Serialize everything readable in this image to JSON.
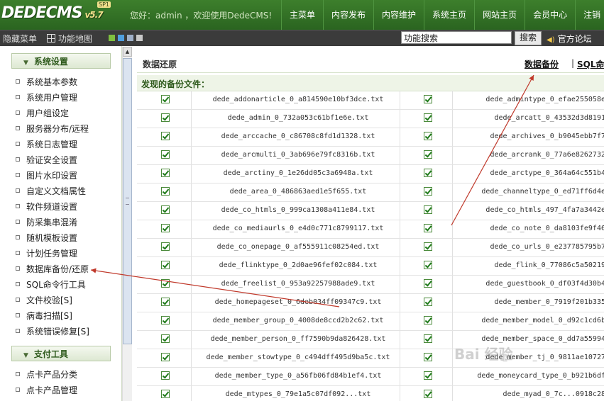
{
  "header": {
    "logo_text": "DEDECMS",
    "version": "v5.7",
    "badge": "SP1",
    "welcome": "您好：admin ，欢迎使用DedeCMS!",
    "nav": [
      "主菜单",
      "内容发布",
      "内容维护",
      "系统主页",
      "网站主页",
      "会员中心",
      "注销"
    ]
  },
  "toolbar": {
    "hide_menu": "隐藏菜单",
    "func_map": "功能地图",
    "search_value": "功能搜索",
    "search_button": "搜索",
    "forum": "官方论坛",
    "swatches": [
      "#7fbf3f",
      "#4f9fe0",
      "#9fb0c8",
      "#c8c8c8"
    ]
  },
  "sidebar": {
    "sections": [
      {
        "title": "系统设置",
        "items": [
          "系统基本参数",
          "系统用户管理",
          "用户组设定",
          "服务器分布/远程",
          "系统日志管理",
          "验证安全设置",
          "图片水印设置",
          "自定义文档属性",
          "软件频道设置",
          "防采集串混淆",
          "随机模板设置",
          "计划任务管理",
          "数据库备份/还原",
          "SQL命令行工具",
          "文件校验[S]",
          "病毒扫描[S]",
          "系统错误修复[S]"
        ]
      },
      {
        "title": "支付工具",
        "items": [
          "点卡产品分类",
          "点卡产品管理"
        ]
      }
    ]
  },
  "main": {
    "title": "数据还原",
    "link_backup": "数据备份",
    "link_sql": "SQL命",
    "subheading": "发现的备份文件：",
    "rows": [
      [
        "dede_addonarticle_0_a814590e10bf3dce.txt",
        "dede_admintype_0_efae255058e"
      ],
      [
        "dede_admin_0_732a053c61bf1e6e.txt",
        "dede_arcatt_0_43532d3d8191"
      ],
      [
        "dede_arccache_0_c86708c8fd1d1328.txt",
        "dede_archives_0_b9045ebb7f7"
      ],
      [
        "dede_arcmulti_0_3ab696e79fc8316b.txt",
        "dede_arcrank_0_77a6e8262732"
      ],
      [
        "dede_arctiny_0_1e26dd05c3a6948a.txt",
        "dede_arctype_0_364a64c551b4"
      ],
      [
        "dede_area_0_486863aed1e5f655.txt",
        "dede_channeltype_0_ed71ff6d4e"
      ],
      [
        "dede_co_htmls_0_999ca1308a411e84.txt",
        "dede_co_htmls_497_4fa7a3442e"
      ],
      [
        "dede_co_mediaurls_0_e4d0c771c8799117.txt",
        "dede_co_note_0_da8103fe9f46"
      ],
      [
        "dede_co_onepage_0_af555911c08254ed.txt",
        "dede_co_urls_0_e237785795b7"
      ],
      [
        "dede_flinktype_0_2d0ae96fef02c084.txt",
        "dede_flink_0_77086c5a50219"
      ],
      [
        "dede_freelist_0_953a92257988ade9.txt",
        "dede_guestbook_0_df03f4d30b4"
      ],
      [
        "dede_homepageset_0_6deb034ff09347c9.txt",
        "dede_member_0_7919f201b335"
      ],
      [
        "dede_member_group_0_4008de8ccd2b2c62.txt",
        "dede_member_model_0_d92c1cd6b"
      ],
      [
        "dede_member_person_0_ff7590b9da826428.txt",
        "dede_member_space_0_dd7a55994"
      ],
      [
        "dede_member_stowtype_0_c494dff495d9ba5c.txt",
        "dede_member_tj_0_9811ae10727"
      ],
      [
        "dede_member_type_0_a56fb06fd84b1ef4.txt",
        "dede_moneycard_type_0_b921b6df"
      ],
      [
        "dede_mtypes_0_79e1a5c07df092...txt",
        "dede_myad_0_7c...0918c28"
      ]
    ]
  },
  "watermark": "Bai 经验"
}
